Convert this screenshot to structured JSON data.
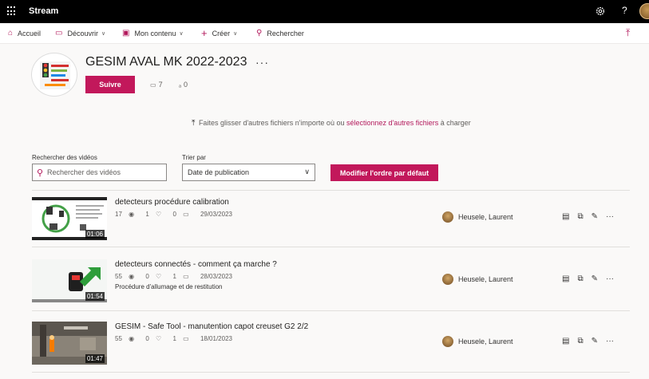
{
  "app": {
    "title": "Stream"
  },
  "nav": {
    "home": "Accueil",
    "discover": "Découvrir",
    "my_content": "Mon contenu",
    "create": "Créer",
    "search": "Rechercher"
  },
  "channel": {
    "title": "GESIM AVAL MK 2022-2023",
    "more": "···",
    "follow_label": "Suivre",
    "video_count": "7",
    "follower_count": "0"
  },
  "upload": {
    "prefix": "Faites glisser d'autres fichiers n'importe où ou",
    "link": "sélectionnez d'autres fichiers",
    "suffix": "à charger"
  },
  "filters": {
    "search_label": "Rechercher des vidéos",
    "search_placeholder": "Rechercher des vidéos",
    "sort_label": "Trier par",
    "sort_value": "Date de publication",
    "reorder_label": "Modifier l'ordre par défaut"
  },
  "videos": [
    {
      "title": "detecteurs procédure calibration",
      "views": "17",
      "likes": "1",
      "comments": "0",
      "date": "29/03/2023",
      "description": "",
      "duration": "01:06",
      "owner": "Heusele, Laurent"
    },
    {
      "title": "detecteurs connectés - comment ça marche ?",
      "views": "55",
      "likes": "0",
      "comments": "1",
      "date": "28/03/2023",
      "description": "Procédure d'allumage et de restitution",
      "duration": "01:54",
      "owner": "Heusele, Laurent"
    },
    {
      "title": "GESIM - Safe Tool - manutention capot creuset G2 2/2",
      "views": "55",
      "likes": "0",
      "comments": "1",
      "date": "18/01/2023",
      "description": "",
      "duration": "01:47",
      "owner": "Heusele, Laurent"
    }
  ],
  "colors": {
    "accent": "#c2185b",
    "link": "#b3195c",
    "topbar": "#000000"
  },
  "icons": {
    "topbar": [
      "waffle-icon",
      "settings-gear-icon",
      "help-icon",
      "user-avatar"
    ],
    "nav": [
      "home-icon",
      "discover-icon",
      "my-content-icon",
      "plus-icon",
      "search-icon",
      "upload-icon"
    ],
    "row_actions": [
      "add-to-group-icon",
      "share-icon",
      "edit-icon",
      "more-icon"
    ]
  }
}
